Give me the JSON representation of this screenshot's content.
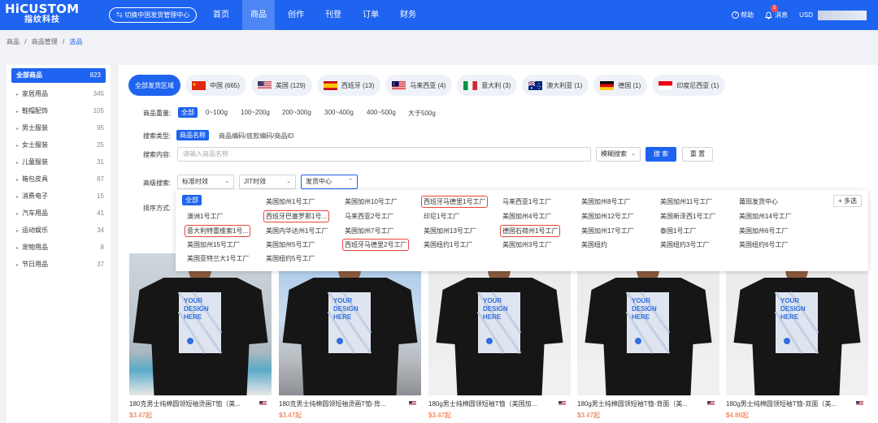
{
  "brand": {
    "name": "HiCUSTOM",
    "subtitle": "指纹科技"
  },
  "header": {
    "switch_label": "⇆ 切换中国发货管理中心",
    "nav": [
      "首页",
      "商品",
      "创作",
      "刊登",
      "订单",
      "财务"
    ],
    "active_nav": "商品",
    "help": "帮助",
    "messages": "消息",
    "message_count": "5",
    "currency": "USD"
  },
  "breadcrumb": {
    "items": [
      "商品",
      "商品管理",
      "选品"
    ],
    "sep": "/"
  },
  "sidebar": {
    "items": [
      {
        "label": "全部商品",
        "count": "823"
      },
      {
        "label": "家居用品",
        "count": "345"
      },
      {
        "label": "鞋帽配饰",
        "count": "105"
      },
      {
        "label": "男士服装",
        "count": "95"
      },
      {
        "label": "女士服装",
        "count": "25"
      },
      {
        "label": "儿童服装",
        "count": "31"
      },
      {
        "label": "箱包皮具",
        "count": "87"
      },
      {
        "label": "消费电子",
        "count": "15"
      },
      {
        "label": "汽车用品",
        "count": "41"
      },
      {
        "label": "运动娱乐",
        "count": "34"
      },
      {
        "label": "宠物用品",
        "count": "8"
      },
      {
        "label": "节日用品",
        "count": "37"
      }
    ]
  },
  "regions": [
    {
      "label": "全部发货区域",
      "flag": ""
    },
    {
      "label": "中国 (665)",
      "flag": "china-flag-icon"
    },
    {
      "label": "美国 (129)",
      "flag": "us-flag-icon"
    },
    {
      "label": "西班牙 (13)",
      "flag": "spain-flag-icon"
    },
    {
      "label": "马来西亚 (4)",
      "flag": "malaysia-flag-icon"
    },
    {
      "label": "意大利 (3)",
      "flag": "italy-flag-icon"
    },
    {
      "label": "澳大利亚 (1)",
      "flag": "australia-flag-icon"
    },
    {
      "label": "德国 (1)",
      "flag": "germany-flag-icon"
    },
    {
      "label": "印度尼西亚 (1)",
      "flag": "indonesia-flag-icon"
    }
  ],
  "filters": {
    "weight_label": "商品重量:",
    "weights": [
      "全部",
      "0~100g",
      "100~200g",
      "200~300g",
      "300~400g",
      "400~500g",
      "大于500g"
    ],
    "search_type_label": "搜索类型:",
    "search_types": [
      "商品名称",
      "商品编码/底款编码/商品ID"
    ],
    "search_content_label": "搜索内容:",
    "search_placeholder": "请输入商品名称",
    "match_select": "模糊搜索",
    "search_btn": "搜 索",
    "reset_btn": "重 置",
    "advanced_label": "高级搜索:",
    "sel1": "标准时效",
    "sel2": "JIT时效",
    "sel3": "发货中心",
    "sort_label": "排序方式:"
  },
  "dropdown": {
    "all_label": "全部",
    "multi_label": "+ 多选",
    "rows": [
      [
        "",
        "美国加州1号工厂",
        "美国加州10号工厂",
        "西班牙马德里1号工厂",
        "马来西亚1号工厂",
        "美国加州8号工厂",
        "美国加州11号工厂",
        "莆田发货中心"
      ],
      [
        "澳洲1号工厂",
        "西班牙巴塞罗那1号...",
        "马来西亚2号工厂",
        "印尼1号工厂",
        "美国加州4号工厂",
        "美国加州12号工厂",
        "美国新泽西1号工厂",
        "美国加州14号工厂"
      ],
      [
        "意大利特雷维索1号...",
        "美国内华达州1号工厂",
        "美国加州7号工厂",
        "美国加州13号工厂",
        "德国石荷州1号工厂",
        "美国加州17号工厂",
        "泰国1号工厂",
        "美国加州6号工厂"
      ],
      [
        "美国加州15号工厂",
        "美国加州5号工厂",
        "西班牙马德里2号工厂",
        "美国纽约1号工厂",
        "美国加州3号工厂",
        "美国纽约",
        "美国纽约3号工厂",
        "美国纽约6号工厂"
      ],
      [
        "美国亚特兰大1号工厂",
        "美国纽约5号工厂",
        "",
        "",
        "",
        "",
        "",
        ""
      ]
    ]
  },
  "products": [
    {
      "title": "180克男士纯棉圆领短袖烫画T恤（美...",
      "price": "$3.47起",
      "flag": "us-flag-icon",
      "design_text": "YOUR DESIGN HERE"
    },
    {
      "title": "180克男士纯棉圆领短袖烫画T恤-背...",
      "price": "$3.47起",
      "flag": "us-flag-icon",
      "design_text": "YOUR DESIGN HERE"
    },
    {
      "title": "180g男士纯棉圆领短袖T恤（美国加...",
      "price": "$3.47起",
      "flag": "us-flag-icon",
      "design_text": "YOUR DESIGN HERE"
    },
    {
      "title": "180g男士纯棉圆领短袖T恤-背面（美...",
      "price": "$3.47起",
      "flag": "us-flag-icon",
      "design_text": "YOUR DESIGN HERE"
    },
    {
      "title": "180g男士纯棉圆领短袖T恤-双面（美...",
      "price": "$4.86起",
      "flag": "us-flag-icon",
      "design_text": "YOUR DESIGN HERE"
    }
  ],
  "colors": {
    "accent": "#1e64f0",
    "price": "#f0642d",
    "highlight": "#e8453c"
  }
}
